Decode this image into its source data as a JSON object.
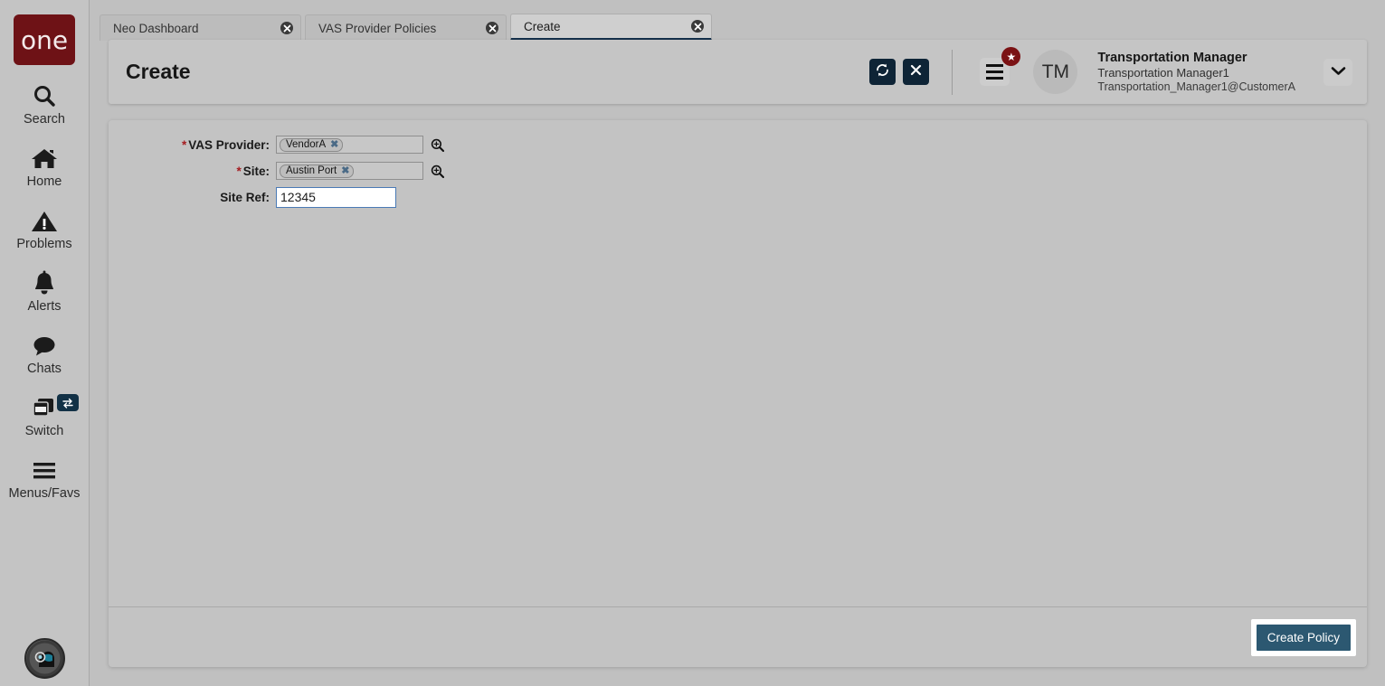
{
  "app": {
    "brand": "one",
    "assistant_icon": "assistant-avatar-icon"
  },
  "sidebar": {
    "items": [
      {
        "label": "Search",
        "icon": "search-icon"
      },
      {
        "label": "Home",
        "icon": "home-icon"
      },
      {
        "label": "Problems",
        "icon": "warning-triangle-icon"
      },
      {
        "label": "Alerts",
        "icon": "bell-icon"
      },
      {
        "label": "Chats",
        "icon": "chat-bubble-icon"
      },
      {
        "label": "Switch",
        "icon": "windows-stack-icon",
        "badge_icon": "swap-arrows-icon"
      },
      {
        "label": "Menus/Favs",
        "icon": "hamburger-icon"
      }
    ]
  },
  "tabs": [
    {
      "label": "Neo Dashboard",
      "active": false,
      "close_icon": "close-circle-icon"
    },
    {
      "label": "VAS Provider Policies",
      "active": false,
      "close_icon": "close-circle-icon"
    },
    {
      "label": "Create",
      "active": true,
      "close_icon": "close-circle-icon"
    }
  ],
  "header": {
    "title": "Create",
    "refresh_icon": "refresh-icon",
    "close_icon": "close-x-icon",
    "menu_icon": "hamburger-menu-icon",
    "star_badge_icon": "star-icon",
    "star_badge_glyph": "★",
    "avatar_initials": "TM",
    "user": {
      "role": "Transportation Manager",
      "name": "Transportation Manager1",
      "account": "Transportation_Manager1@CustomerA"
    },
    "chevron_icon": "chevron-down-icon"
  },
  "form": {
    "fields": [
      {
        "id": "vas-provider",
        "label": "VAS Provider:",
        "required": true,
        "type": "chips",
        "chips": [
          {
            "text": "VendorA",
            "remove_icon": "chip-remove-icon"
          }
        ],
        "lookup_icon": "magnifier-plus-icon"
      },
      {
        "id": "site",
        "label": "Site:",
        "required": true,
        "type": "chips",
        "chips": [
          {
            "text": "Austin Port",
            "remove_icon": "chip-remove-icon"
          }
        ],
        "lookup_icon": "magnifier-plus-icon"
      },
      {
        "id": "site-ref",
        "label": "Site Ref:",
        "required": false,
        "type": "text",
        "value": "12345",
        "placeholder": ""
      }
    ]
  },
  "footer": {
    "primary_button": "Create Policy"
  },
  "colors": {
    "brand_maroon": "#6e1216",
    "accent_navy": "#0e2436",
    "primary_button": "#2c5871",
    "required_red": "#a51c20",
    "badge_red": "#7b1214",
    "focus_blue": "#4a7ab5",
    "page_bg": "#c0c0c0",
    "panel_bg": "#c3c3c3",
    "active_tab_underline": "#15304a"
  }
}
